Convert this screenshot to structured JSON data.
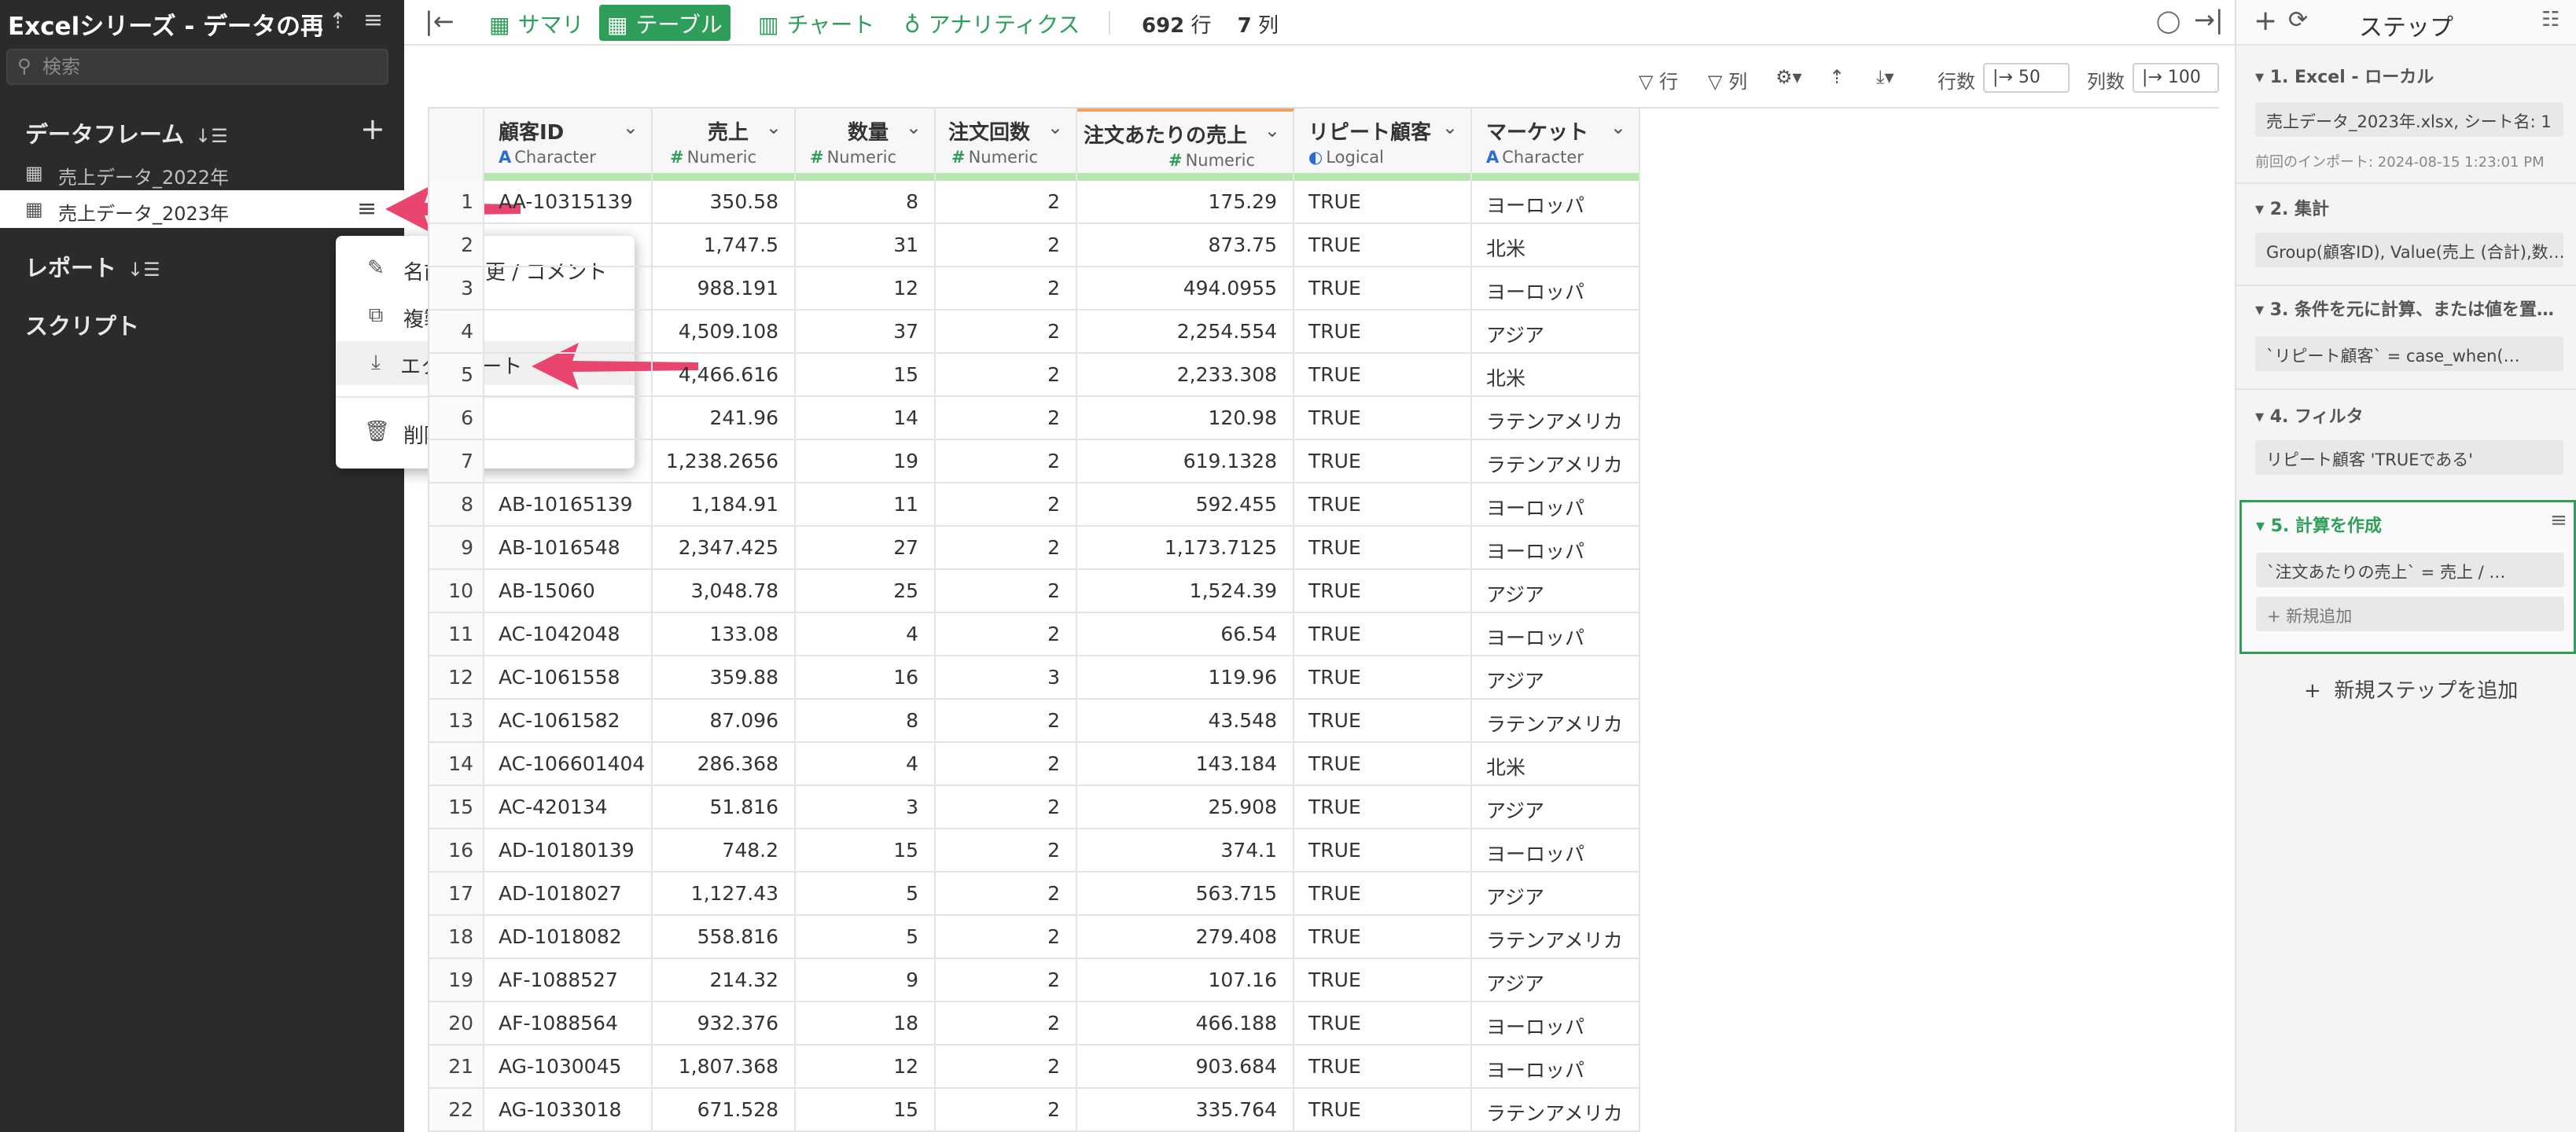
{
  "sidebar": {
    "title": "Excelシリーズ - データの再…",
    "search_placeholder": "検索",
    "dataframes_label": "データフレーム",
    "dataframes": [
      "売上データ_2022年",
      "売上データ_2023年"
    ],
    "reports_label": "レポート",
    "scripts_label": "スクリプト",
    "context_menu": {
      "rename": "名前の変更 / コメント",
      "duplicate": "複製",
      "export": "エクスポート",
      "delete": "削除"
    }
  },
  "toolbar": {
    "tabs": {
      "summary": "サマリ",
      "table": "テーブル",
      "chart": "チャート",
      "analytics": "アナリティクス"
    },
    "rows_value": "692",
    "rows_unit": "行",
    "cols_value": "7",
    "cols_unit": "列"
  },
  "table_tools": {
    "row_filter": "行",
    "col_filter": "列",
    "rows_label": "行数",
    "rows_value": "|→ 50",
    "cols_label": "列数",
    "cols_value": "|→ 100"
  },
  "table": {
    "columns": [
      {
        "name": "顧客ID",
        "type": "Character"
      },
      {
        "name": "売上",
        "type": "Numeric"
      },
      {
        "name": "数量",
        "type": "Numeric"
      },
      {
        "name": "注文回数",
        "type": "Numeric"
      },
      {
        "name": "注文あたりの売上",
        "type": "Numeric"
      },
      {
        "name": "リピート顧客",
        "type": "Logical"
      },
      {
        "name": "マーケット",
        "type": "Character"
      }
    ],
    "rows": [
      [
        "1",
        "AA-10315139",
        "350.58",
        "8",
        "2",
        "175.29",
        "TRUE",
        "ヨーロッパ"
      ],
      [
        "2",
        "",
        "1,747.5",
        "31",
        "2",
        "873.75",
        "TRUE",
        "北米"
      ],
      [
        "3",
        "",
        "988.191",
        "12",
        "2",
        "494.0955",
        "TRUE",
        "ヨーロッパ"
      ],
      [
        "4",
        "",
        "4,509.108",
        "37",
        "2",
        "2,254.554",
        "TRUE",
        "アジア"
      ],
      [
        "5",
        "",
        "4,466.616",
        "15",
        "2",
        "2,233.308",
        "TRUE",
        "北米"
      ],
      [
        "6",
        "",
        "241.96",
        "14",
        "2",
        "120.98",
        "TRUE",
        "ラテンアメリカ"
      ],
      [
        "7",
        "",
        "1,238.2656",
        "19",
        "2",
        "619.1328",
        "TRUE",
        "ラテンアメリカ"
      ],
      [
        "8",
        "AB-10165139",
        "1,184.91",
        "11",
        "2",
        "592.455",
        "TRUE",
        "ヨーロッパ"
      ],
      [
        "9",
        "AB-1016548",
        "2,347.425",
        "27",
        "2",
        "1,173.7125",
        "TRUE",
        "ヨーロッパ"
      ],
      [
        "10",
        "AB-15060",
        "3,048.78",
        "25",
        "2",
        "1,524.39",
        "TRUE",
        "アジア"
      ],
      [
        "11",
        "AC-1042048",
        "133.08",
        "4",
        "2",
        "66.54",
        "TRUE",
        "ヨーロッパ"
      ],
      [
        "12",
        "AC-1061558",
        "359.88",
        "16",
        "3",
        "119.96",
        "TRUE",
        "アジア"
      ],
      [
        "13",
        "AC-1061582",
        "87.096",
        "8",
        "2",
        "43.548",
        "TRUE",
        "ラテンアメリカ"
      ],
      [
        "14",
        "AC-106601404",
        "286.368",
        "4",
        "2",
        "143.184",
        "TRUE",
        "北米"
      ],
      [
        "15",
        "AC-420134",
        "51.816",
        "3",
        "2",
        "25.908",
        "TRUE",
        "アジア"
      ],
      [
        "16",
        "AD-10180139",
        "748.2",
        "15",
        "2",
        "374.1",
        "TRUE",
        "ヨーロッパ"
      ],
      [
        "17",
        "AD-1018027",
        "1,127.43",
        "5",
        "2",
        "563.715",
        "TRUE",
        "アジア"
      ],
      [
        "18",
        "AD-1018082",
        "558.816",
        "5",
        "2",
        "279.408",
        "TRUE",
        "ラテンアメリカ"
      ],
      [
        "19",
        "AF-1088527",
        "214.32",
        "9",
        "2",
        "107.16",
        "TRUE",
        "アジア"
      ],
      [
        "20",
        "AF-1088564",
        "932.376",
        "18",
        "2",
        "466.188",
        "TRUE",
        "ヨーロッパ"
      ],
      [
        "21",
        "AG-1030045",
        "1,807.368",
        "12",
        "2",
        "903.684",
        "TRUE",
        "ヨーロッパ"
      ],
      [
        "22",
        "AG-1033018",
        "671.528",
        "15",
        "2",
        "335.764",
        "TRUE",
        "ラテンアメリカ"
      ]
    ]
  },
  "steps": {
    "title": "ステップ",
    "items": [
      {
        "header": "1. Excel - ローカル",
        "content": "売上データ_2023年.xlsx, シート名: 1",
        "meta": "前回のインポート: 2024-08-15 1:23:01 PM"
      },
      {
        "header": "2. 集計",
        "content": "Group(顧客ID), Value(売上 (合計),数…"
      },
      {
        "header": "3. 条件を元に計算、または値を置…",
        "content": "`リピート顧客` = case_when(…"
      },
      {
        "header": "4. フィルタ",
        "content": "リピート顧客 'TRUEである'"
      },
      {
        "header": "5. 計算を作成",
        "content": "`注文あたりの売上` = 売上 / …",
        "add_new": "+ 新規追加"
      }
    ],
    "add_step": "新規ステップを追加"
  },
  "colors": {
    "accent_green": "#2e9e5a",
    "sidebar_bg": "#2b2b2b",
    "arrow_pink": "#e8466e"
  }
}
